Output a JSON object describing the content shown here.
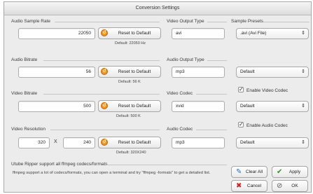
{
  "window": {
    "title": "Conversion Settings"
  },
  "audio_sample_rate": {
    "title": "Audio Sample Rate",
    "value": "22050",
    "reset_label": "Reset to Default",
    "default_hint": "Default: 22050 Hz"
  },
  "audio_bitrate": {
    "title": "Audio Bitrate",
    "value": "56",
    "reset_label": "Reset to Default",
    "default_hint": "Default: 56 K"
  },
  "video_bitrate": {
    "title": "Video Bitrate",
    "value": "500",
    "reset_label": "Reset to Default",
    "default_hint": "Default: 500 K"
  },
  "video_resolution": {
    "title": "Video Resolution",
    "width": "320",
    "separator": "X",
    "height": "240",
    "reset_label": "Reset to Default",
    "default_hint": "Default: 320X240"
  },
  "video_output_type": {
    "title": "Video Output Type",
    "value": "avi"
  },
  "audio_output_type": {
    "title": "Audio Output Type",
    "value": "mp3"
  },
  "video_codec": {
    "title": "Video Codec",
    "value": "xvid"
  },
  "audio_codec": {
    "title": "Audio Codec",
    "value": "mp3"
  },
  "sample_presets": {
    "title": "Sample Presets",
    "preset_value": ".avi (Avi File)",
    "audio_output_select": "Default",
    "enable_video_codec_label": "Enable Video Codec",
    "video_codec_select": "Default",
    "enable_audio_codec_label": "Enable Audio Codec",
    "audio_codec_select": "Default"
  },
  "info": {
    "title": "Utube Ripper support all ffmpeg codecs/formats",
    "text": "ffmpeg support a lot of codecs/formats, you can open a terminal and try \"ffmpeg -formats\" to get a detailed list."
  },
  "actions": {
    "clear_all": "Clear All",
    "apply": "Apply",
    "cancel": "Cancel",
    "ok": "OK"
  },
  "colors": {
    "window_bg": "#ececec",
    "reset_icon": "#ea7a00",
    "clear_icon": "#2a6fd1",
    "apply_icon": "#2f8f2f",
    "cancel_icon": "#d02020"
  }
}
